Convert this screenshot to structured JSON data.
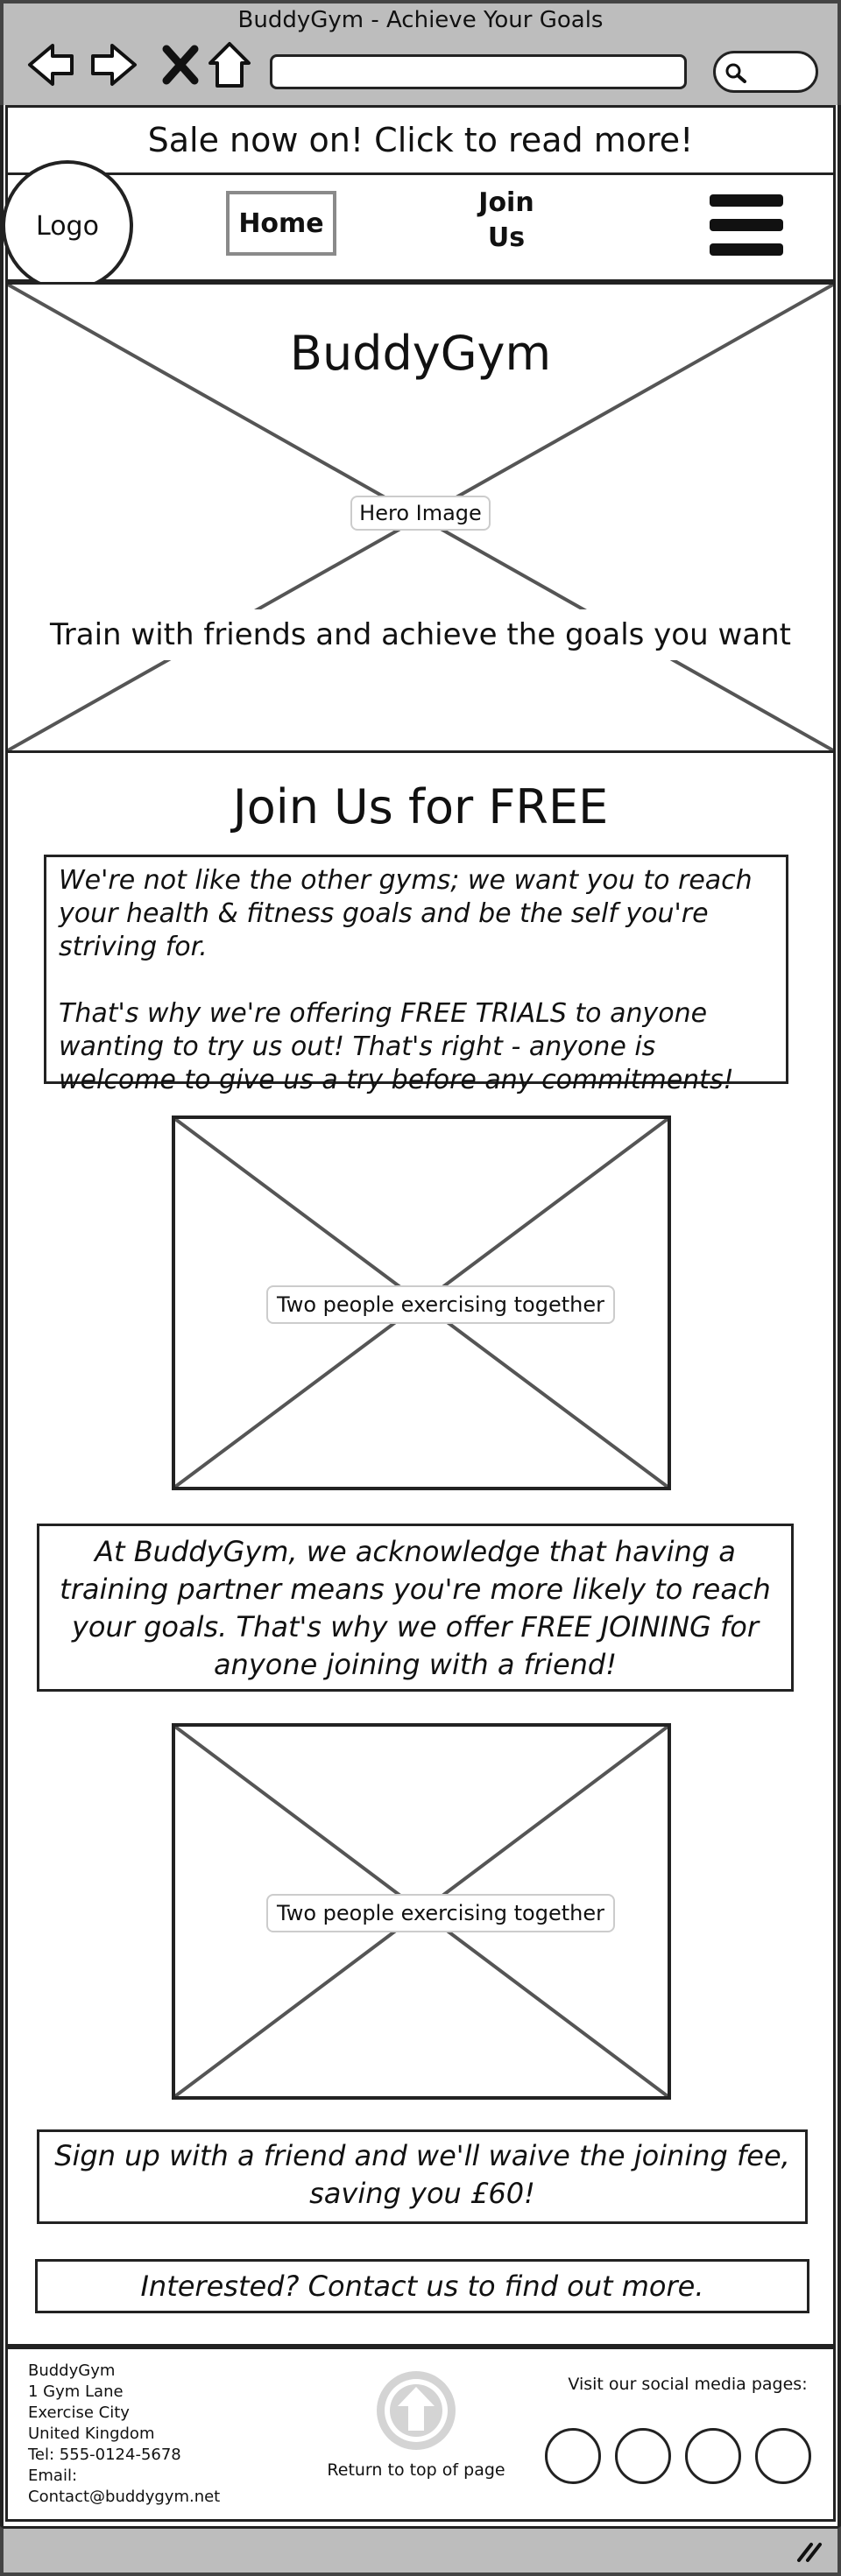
{
  "browser": {
    "window_title": "BuddyGym - Achieve Your Goals",
    "nav_icons": [
      "back-arrow-icon",
      "forward-arrow-icon",
      "close-x-icon",
      "home-icon"
    ],
    "search_icon": "magnifier-icon"
  },
  "sale_banner": {
    "text": "Sale now on! Click to read more!"
  },
  "navbar": {
    "logo": "Logo",
    "home": "Home",
    "join_line1": "Join",
    "join_line2": "Us",
    "menu_icon": "hamburger-menu-icon"
  },
  "hero": {
    "title": "BuddyGym",
    "image_label": "Hero Image",
    "tagline": "Train with friends and achieve the goals you want"
  },
  "main": {
    "title": "Join Us for FREE",
    "intro_p1": "We're not like the other gyms; we want you to reach your health & fitness goals and be the self you're striving for.",
    "intro_p2": "That's why we're offering FREE TRIALS to anyone wanting to try us out! That's right - anyone is welcome to give us a try before any commitments!",
    "image1_label": "Two people exercising together",
    "partner_text": "At BuddyGym, we acknowledge that having a training partner means you're more likely to reach your goals. That's why we offer FREE JOINING for anyone joining with a friend!",
    "image2_label": "Two people exercising together",
    "signup_text": "Sign up with a friend and we'll waive the joining fee, saving you £60!",
    "contact_text": "Interested? Contact us to find out more."
  },
  "footer": {
    "address": [
      "BuddyGym",
      "1 Gym Lane",
      "Exercise City",
      "United Kingdom",
      "Tel: 555-0124-5678",
      "Email:",
      "Contact@buddygym.net"
    ],
    "top_icon": "arrow-up-circle-icon",
    "top_label": "Return to top of page",
    "social_label": "Visit our social media pages:",
    "social_count": 4
  },
  "colors": {
    "chrome": "#bdbdbd",
    "border": "#222222",
    "placeholder_line": "#555555",
    "top_button": "#d4d4d4"
  }
}
